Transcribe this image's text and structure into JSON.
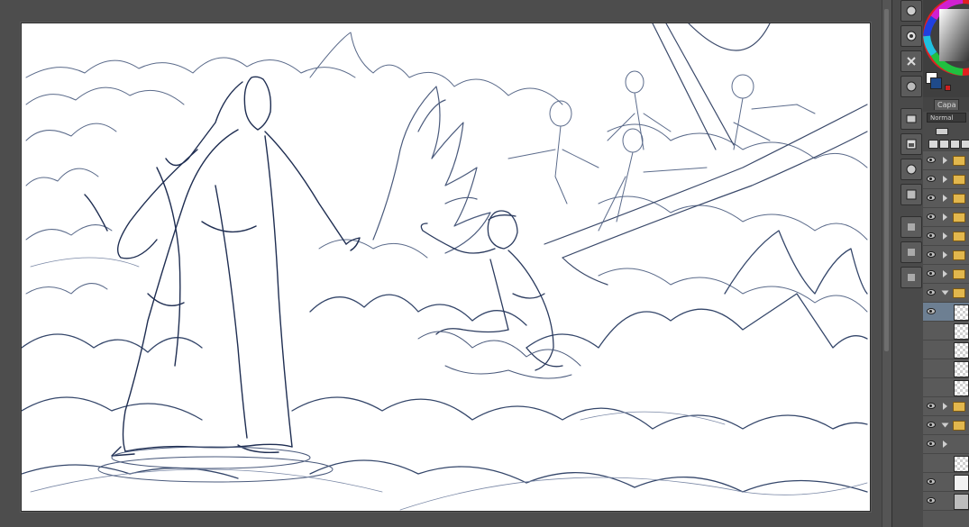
{
  "app": {
    "canvas_name": "storm-sea-illustration-canvas"
  },
  "panel": {
    "layer_tab_label": "Capa",
    "blend_mode": "Normal",
    "colors": {
      "main": "#ffffff",
      "sub": "#1f4a8a",
      "accent": "#cc2020"
    }
  },
  "icons": {
    "tools": [
      "brush-tool-icon",
      "pen-tool-icon",
      "eraser-tool-icon",
      "fill-tool-icon",
      "selection-tool-icon",
      "layer-tool-icon",
      "move-tool-icon",
      "text-tool-icon"
    ],
    "layer_panel": [
      "eye-icon",
      "folder-icon",
      "expand-arrow-icon"
    ]
  }
}
